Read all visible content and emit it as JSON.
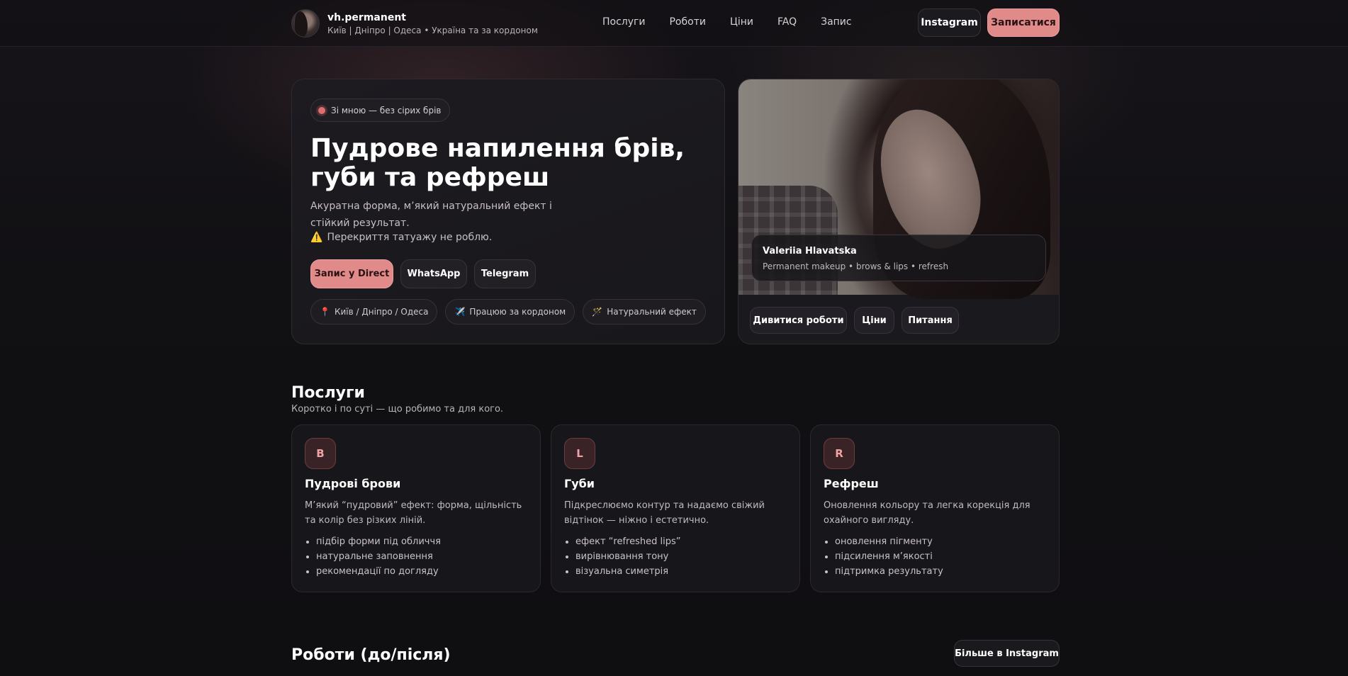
{
  "header": {
    "brand_name": "vh.permanent",
    "brand_sub": "Київ | Дніпро | Одеса • Україна та за кордоном",
    "nav": [
      "Послуги",
      "Роботи",
      "Ціни",
      "FAQ",
      "Запис"
    ],
    "instagram_label": "Instagram",
    "book_label": "Записатися"
  },
  "hero": {
    "tag": "Зі мною — без сірих брів",
    "title": "Пудрове напилення брів, губи та рефреш",
    "desc": "Акуратна форма, м’який натуральний ефект і стійкий результат.",
    "warning": "Перекриття татуажу не роблю.",
    "cta_direct": "Запис у Direct",
    "cta_whatsapp": "WhatsApp",
    "cta_telegram": "Telegram",
    "chips": [
      {
        "icon": "📍",
        "label": "Київ / Дніпро / Одеса"
      },
      {
        "icon": "✈️",
        "label": "Працюю за кордоном"
      },
      {
        "icon": "🪄",
        "label": "Натуральний ефект"
      }
    ],
    "photo_caption_name": "Valeriia Hlavatska",
    "photo_caption_sub": "Permanent makeup • brows & lips • refresh",
    "btn_works": "Дивитися роботи",
    "btn_prices": "Ціни",
    "btn_faq": "Питання"
  },
  "services": {
    "title": "Послуги",
    "subtitle": "Коротко і по суті — що робимо та для кого.",
    "cards": [
      {
        "icon": "B",
        "title": "Пудрові брови",
        "desc": "М’який “пудровий” ефект: форма, щільність та колір без різких ліній.",
        "items": [
          "підбір форми під обличчя",
          "натуральне заповнення",
          "рекомендації по догляду"
        ]
      },
      {
        "icon": "L",
        "title": "Губи",
        "desc": "Підкреслюємо контур та надаємо свіжий відтінок — ніжно і естетично.",
        "items": [
          "ефект “refreshed lips”",
          "вирівнювання тону",
          "візуальна симетрія"
        ]
      },
      {
        "icon": "R",
        "title": "Рефреш",
        "desc": "Оновлення кольору та легка корекція для охайного вигляду.",
        "items": [
          "оновлення пігменту",
          "підсилення м’якості",
          "підтримка результату"
        ]
      }
    ]
  },
  "works": {
    "title": "Роботи (до/після)",
    "more_label": "Більше в Instagram"
  }
}
